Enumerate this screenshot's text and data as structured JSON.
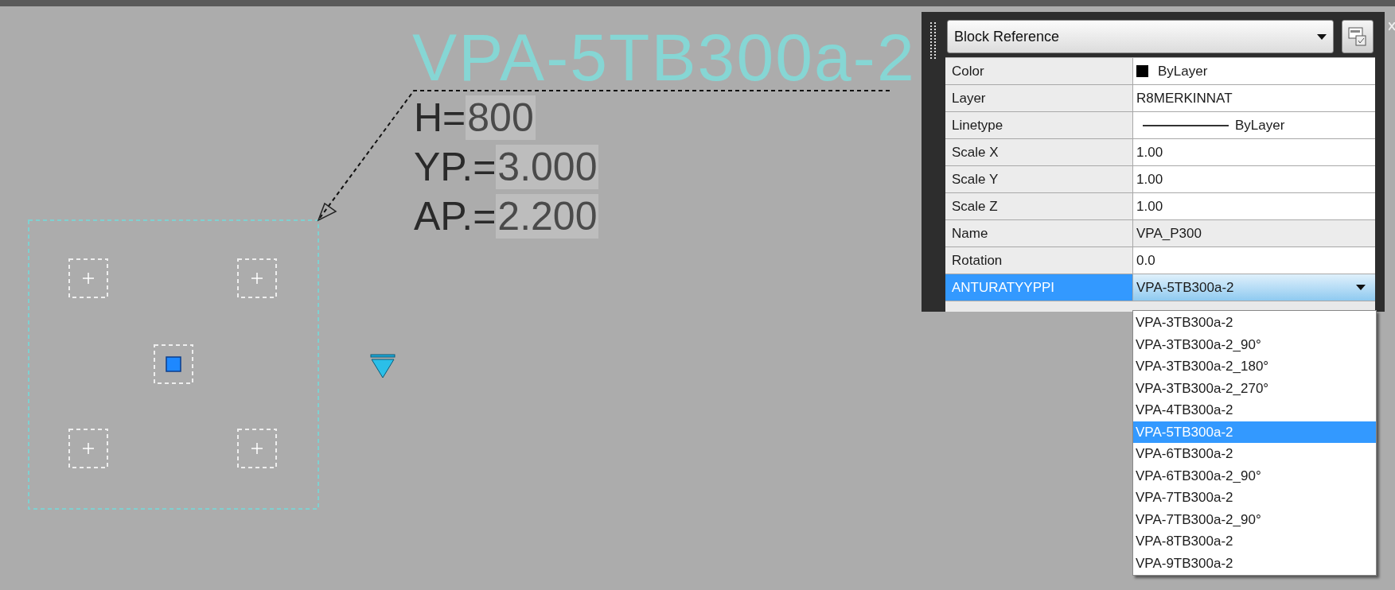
{
  "canvas": {
    "block_title": "VPA-5TB300a-2",
    "attributes": [
      {
        "label": "H=",
        "value": "800"
      },
      {
        "label": "YP.=",
        "value": "3.000"
      },
      {
        "label": "AP.=",
        "value": "2.200"
      }
    ]
  },
  "properties": {
    "object_type": "Block Reference",
    "rows": [
      {
        "name": "Color",
        "value": "ByLayer",
        "kind": "color",
        "selected": false
      },
      {
        "name": "Layer",
        "value": "R8MERKINNAT",
        "kind": "text",
        "selected": false
      },
      {
        "name": "Linetype",
        "value": "ByLayer",
        "kind": "linetype",
        "selected": false
      },
      {
        "name": "Scale X",
        "value": "1.00",
        "kind": "text",
        "selected": false
      },
      {
        "name": "Scale Y",
        "value": "1.00",
        "kind": "text",
        "selected": false
      },
      {
        "name": "Scale Z",
        "value": "1.00",
        "kind": "text",
        "selected": false
      },
      {
        "name": "Name",
        "value": "VPA_P300",
        "kind": "readonly",
        "selected": false
      },
      {
        "name": "Rotation",
        "value": "0.0",
        "kind": "text",
        "selected": false
      },
      {
        "name": "ANTURATYYPPI",
        "value": "VPA-5TB300a-2",
        "kind": "dropdown",
        "selected": true
      }
    ],
    "dropdown_options": [
      {
        "label": "VPA-3TB300a-2",
        "selected": false
      },
      {
        "label": "VPA-3TB300a-2_90°",
        "selected": false
      },
      {
        "label": "VPA-3TB300a-2_180°",
        "selected": false
      },
      {
        "label": "VPA-3TB300a-2_270°",
        "selected": false
      },
      {
        "label": "VPA-4TB300a-2",
        "selected": false
      },
      {
        "label": "VPA-5TB300a-2",
        "selected": true
      },
      {
        "label": "VPA-6TB300a-2",
        "selected": false
      },
      {
        "label": "VPA-6TB300a-2_90°",
        "selected": false
      },
      {
        "label": "VPA-7TB300a-2",
        "selected": false
      },
      {
        "label": "VPA-7TB300a-2_90°",
        "selected": false
      },
      {
        "label": "VPA-8TB300a-2",
        "selected": false
      },
      {
        "label": "VPA-9TB300a-2",
        "selected": false
      }
    ]
  }
}
